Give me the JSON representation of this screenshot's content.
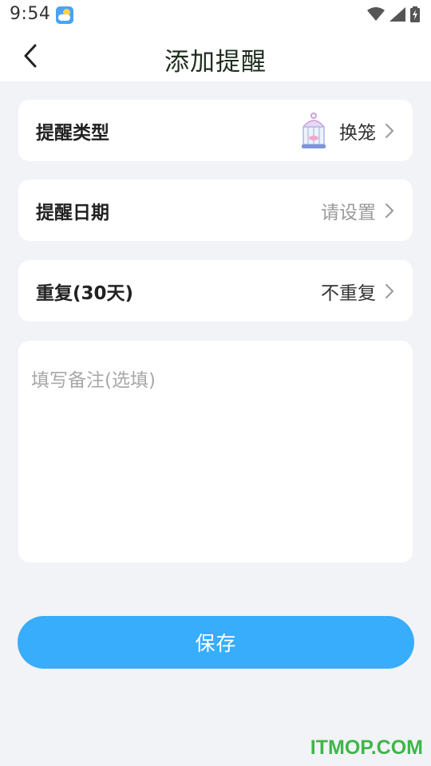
{
  "status_bar": {
    "time": "9:54",
    "weather_icon": "weather-partly-cloudy-icon",
    "wifi_icon": "wifi-icon",
    "signal_icon": "cellular-signal-icon",
    "battery_icon": "battery-charging-icon"
  },
  "header": {
    "back_icon": "chevron-left-icon",
    "title": "添加提醒"
  },
  "rows": {
    "type": {
      "label": "提醒类型",
      "value": "换笼",
      "icon": "bird-cage-icon"
    },
    "date": {
      "label": "提醒日期",
      "value": "请设置"
    },
    "repeat": {
      "label": "重复(30天)",
      "value": "不重复"
    }
  },
  "notes": {
    "placeholder": "填写备注(选填)",
    "value": ""
  },
  "save_label": "保存",
  "watermark": "ITMOP.COM",
  "colors": {
    "accent": "#37adfb",
    "background": "#f2f3f7",
    "card": "#ffffff",
    "placeholder": "#9a9a9a",
    "watermark": "#3fb64a"
  }
}
